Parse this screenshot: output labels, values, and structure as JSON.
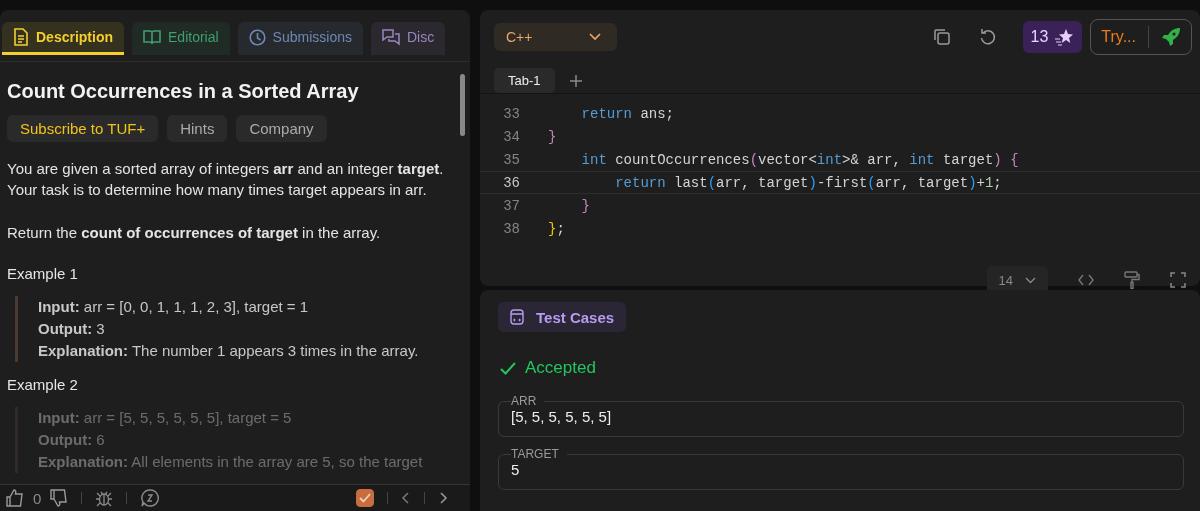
{
  "problem_panel": {
    "tabs": [
      {
        "label": "Description",
        "selected": true,
        "color": "#f5cf2e"
      },
      {
        "label": "Editorial",
        "selected": false,
        "color": "#3f9f6f"
      },
      {
        "label": "Submissions",
        "selected": false,
        "color": "#6d89b3"
      },
      {
        "label": "Disc",
        "selected": false,
        "color": "#9a86bd"
      }
    ],
    "title": "Count Occurrences in a Sorted Array",
    "tags": [
      {
        "label": "Subscribe to TUF+",
        "kind": "premium"
      },
      {
        "label": "Hints",
        "kind": "plain"
      },
      {
        "label": "Company",
        "kind": "plain"
      }
    ],
    "paragraphs": [
      "You are given a sorted array of integers **arr** and an integer **target**. Your task is to determine how many times target appears in arr.",
      "Return the **count of occurrences of target** in the array."
    ],
    "examples": [
      {
        "heading": "Example 1",
        "faded": false,
        "lines": [
          "**Input:** arr = [0, 0, 1, 1, 1, 2, 3], target = 1",
          "**Output:** 3",
          "**Explanation:** The number 1 appears 3 times in the array."
        ]
      },
      {
        "heading": "Example 2",
        "faded": true,
        "lines": [
          "**Input:** arr = [5, 5, 5, 5, 5, 5], target = 5",
          "**Output:** 6",
          "**Explanation:** All elements in the array are 5, so the target"
        ]
      }
    ],
    "footer": {
      "likes": "0",
      "solved": true
    }
  },
  "editor": {
    "language": "C++",
    "stars": "13",
    "try_button": "Try...",
    "tabs": [
      {
        "label": "Tab-1",
        "selected": true
      }
    ],
    "lines": [
      {
        "number": "33",
        "current": false,
        "tokens": [
          {
            "text": "    return",
            "kind": "keyword"
          },
          {
            "text": " ans;",
            "kind": "plain"
          }
        ]
      },
      {
        "number": "34",
        "current": false,
        "tokens": [
          {
            "text": "}",
            "kind": "bracket"
          }
        ]
      },
      {
        "number": "35",
        "current": false,
        "tokens": [
          {
            "text": "    int",
            "kind": "keyword"
          },
          {
            "text": " countOccurrences",
            "kind": "plain"
          },
          {
            "text": "(",
            "kind": "bracket"
          },
          {
            "text": "vector<",
            "kind": "plain"
          },
          {
            "text": "int",
            "kind": "keyword"
          },
          {
            "text": ">& arr, ",
            "kind": "plain"
          },
          {
            "text": "int",
            "kind": "keyword"
          },
          {
            "text": " target",
            "kind": "plain"
          },
          {
            "text": ")",
            "kind": "bracket"
          },
          {
            "text": " {",
            "kind": "bracket"
          }
        ]
      },
      {
        "number": "36",
        "current": true,
        "tokens": [
          {
            "text": "        return",
            "kind": "keyword"
          },
          {
            "text": " last",
            "kind": "plain"
          },
          {
            "text": "(",
            "kind": "paren"
          },
          {
            "text": "arr, target",
            "kind": "plain"
          },
          {
            "text": ")",
            "kind": "paren"
          },
          {
            "text": "-first",
            "kind": "plain"
          },
          {
            "text": "(",
            "kind": "paren"
          },
          {
            "text": "arr, target",
            "kind": "plain"
          },
          {
            "text": ")",
            "kind": "paren"
          },
          {
            "text": "+",
            "kind": "plain"
          },
          {
            "text": "1",
            "kind": "number"
          },
          {
            "text": ";",
            "kind": "plain"
          }
        ]
      },
      {
        "number": "37",
        "current": false,
        "tokens": [
          {
            "text": "    }",
            "kind": "bracket"
          }
        ]
      },
      {
        "number": "38",
        "current": false,
        "tokens": [
          {
            "text": "}",
            "kind": "outer"
          },
          {
            "text": ";",
            "kind": "plain"
          }
        ]
      }
    ],
    "font_size": "14"
  },
  "test_panel": {
    "tab": "Test Cases",
    "status": "Accepted",
    "accepted": true,
    "fields": [
      {
        "label": "ARR",
        "value": "[5, 5, 5, 5, 5, 5]"
      },
      {
        "label": "TARGET",
        "value": "5"
      }
    ]
  }
}
